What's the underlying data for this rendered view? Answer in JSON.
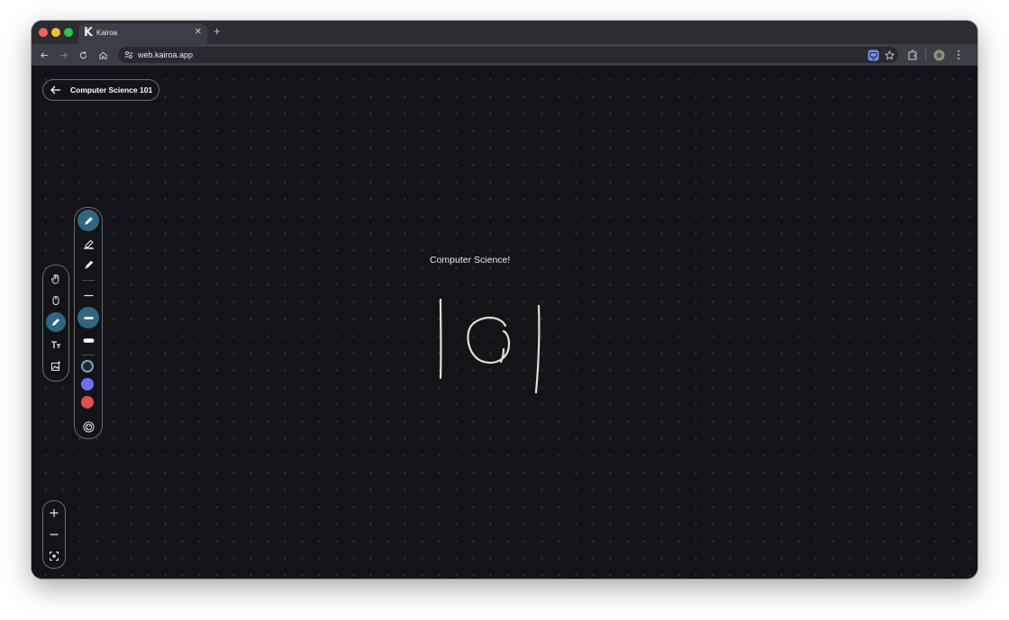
{
  "browser": {
    "tab": {
      "title": "Kairoa",
      "favicon": "K"
    },
    "url": "web.kairoa.app"
  },
  "app": {
    "back_button_label": "Computer Science 101",
    "canvas_text": "Computer Science!",
    "left_toolbar": [
      "hand-icon",
      "mouse-icon",
      "pen-icon",
      "text-icon",
      "image-icon"
    ],
    "left_toolbar_active": "pen-icon",
    "pen_panel": {
      "pen_types": [
        "pen-icon",
        "highlighter-icon",
        "marker-icon"
      ],
      "active_pen_type": "pen-icon",
      "stroke_widths": [
        "thin",
        "medium",
        "thick"
      ],
      "active_stroke_width": "medium",
      "colors": [
        "#1f2a36",
        "#6b70f0",
        "#e0504a"
      ],
      "palette_icon": "palette-icon"
    },
    "zoom_controls": [
      "zoom-in-icon",
      "zoom-out-icon",
      "fit-screen-icon"
    ]
  }
}
